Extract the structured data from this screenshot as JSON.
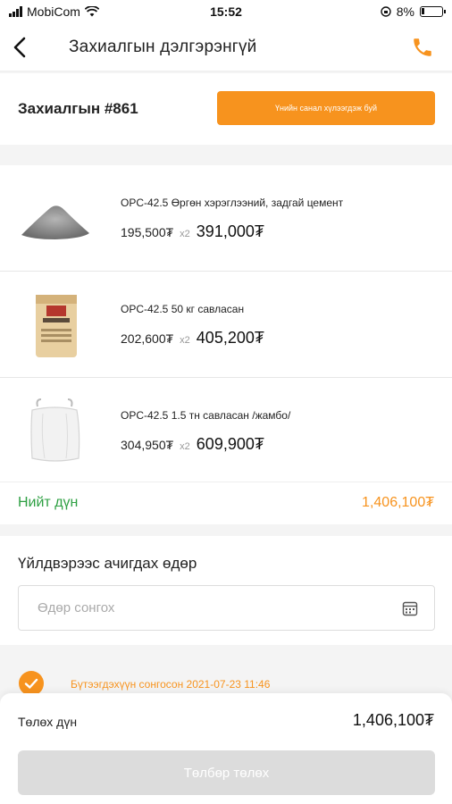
{
  "status_bar": {
    "carrier": "MobiCom",
    "time": "15:52",
    "battery": "8%"
  },
  "nav": {
    "title": "Захиалгын дэлгэрэнгүй",
    "back_icon": "chevron-left-icon",
    "call_icon": "phone-icon"
  },
  "order": {
    "number": "Захиалгын #861",
    "quote_button_label": "Үнийн санал хүлээгдэж буй"
  },
  "products": [
    {
      "name": "OPC-42.5 Өргөн хэрэглээний, задгай цемент",
      "unit_price": "195,500₮",
      "qty": "x2",
      "total": "391,000₮",
      "image": "cement-pile"
    },
    {
      "name": "OPC-42.5 50 кг савласан",
      "unit_price": "202,600₮",
      "qty": "x2",
      "total": "405,200₮",
      "image": "cement-bag"
    },
    {
      "name": "OPC-42.5 1.5 тн савласан /жамбо/",
      "unit_price": "304,950₮",
      "qty": "x2",
      "total": "609,900₮",
      "image": "jumbo-bag"
    }
  ],
  "totals": {
    "label": "Нийт дүн",
    "value": "1,406,100₮"
  },
  "shipping_date": {
    "label": "Үйлдвэрээс ачигдах өдөр",
    "placeholder": "Өдөр сонгох"
  },
  "status": {
    "text": "Бүтээгдэхүүн сонгосон 2021-07-23 11:46"
  },
  "payment": {
    "label": "Төлөх дүн",
    "amount": "1,406,100₮",
    "button_label": "Төлбөр төлөх"
  },
  "colors": {
    "accent": "#f7931e",
    "success": "#2ea043",
    "disabled": "#dcdcdc"
  }
}
